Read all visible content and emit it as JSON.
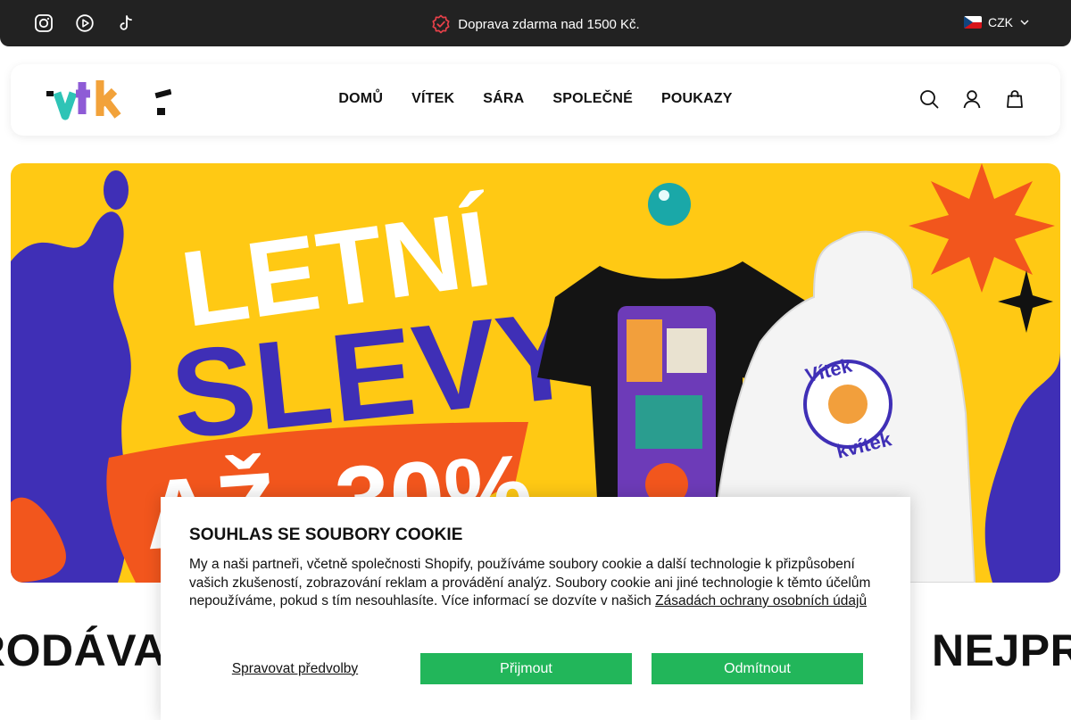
{
  "topbar": {
    "social_icons": [
      "instagram-icon",
      "youtube-icon",
      "tiktok-icon"
    ],
    "announcement": "Doprava zdarma nad 1500 Kč.",
    "currency": "CZK"
  },
  "header": {
    "logo_text": "vtk",
    "nav": [
      {
        "label": "DOMŮ"
      },
      {
        "label": "VÍTEK"
      },
      {
        "label": "SÁRA"
      },
      {
        "label": "SPOLEČNÉ"
      },
      {
        "label": "POUKAZY"
      }
    ],
    "icons": [
      "search-icon",
      "account-icon",
      "cart-icon"
    ]
  },
  "hero": {
    "line1": "LETNÍ",
    "line2": "SLEVY",
    "line3": "AŽ -30%",
    "hoodie_print": [
      "Vítek",
      "kvítek"
    ],
    "colors": {
      "background": "#ffc914",
      "blue": "#3f2fb6",
      "orange": "#f2561d",
      "teal": "#1aa8a8"
    }
  },
  "marquee": {
    "left_text": "RODÁVA",
    "right_text": "NEJPR"
  },
  "cookie": {
    "title": "SOUHLAS SE SOUBORY COOKIE",
    "body": "My a naši partneři, včetně společnosti Shopify, používáme soubory cookie a další technologie k přizpůsobení vašich zkušeností, zobrazování reklam a provádění analýz. Soubory cookie ani jiné technologie k těmto účelům nepoužíváme, pokud s tím nesouhlasíte. Více informací se dozvíte v našich",
    "link": "Zásadách ochrany osobních údajů",
    "manage_label": "Spravovat předvolby",
    "accept_label": "Přijmout",
    "decline_label": "Odmítnout",
    "button_color": "#22b65a"
  }
}
